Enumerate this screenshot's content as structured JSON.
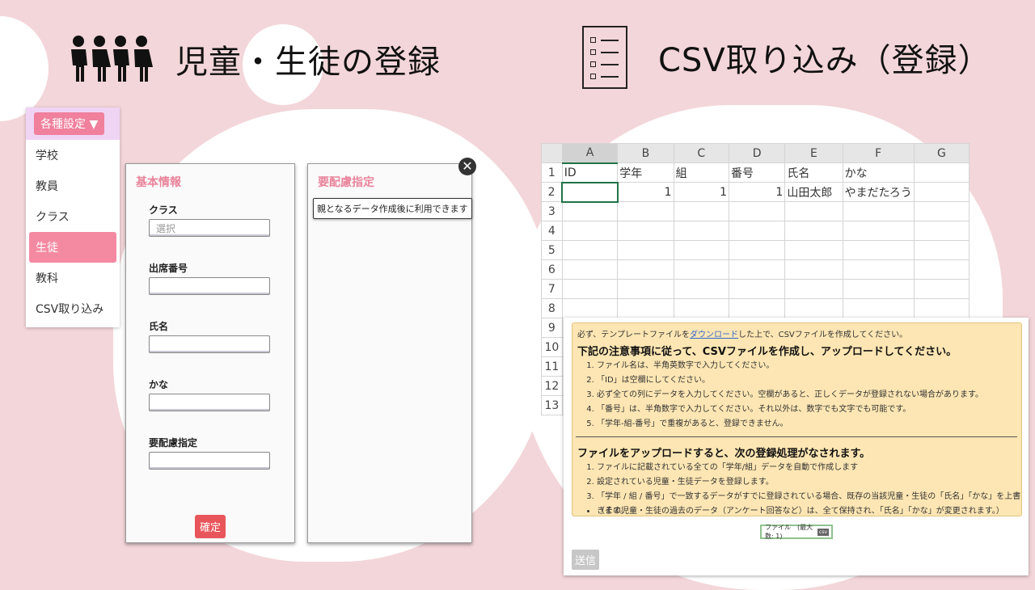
{
  "left_title": {
    "icon": "people-icon",
    "text": "児童・生徒の登録"
  },
  "right_title": {
    "icon": "checklist-icon",
    "text": "CSV取り込み（登録）"
  },
  "settings_menu": {
    "button_label": "各種設定 ▼",
    "items": [
      {
        "label": "学校",
        "active": false
      },
      {
        "label": "教員",
        "active": false
      },
      {
        "label": "クラス",
        "active": false
      },
      {
        "label": "生徒",
        "active": true
      },
      {
        "label": "教科",
        "active": false
      },
      {
        "label": "CSV取り込み",
        "active": false
      }
    ]
  },
  "basic_info": {
    "title": "基本情報",
    "fields": {
      "class_label": "クラス",
      "class_placeholder": "選択",
      "number_label": "出席番号",
      "name_label": "氏名",
      "kana_label": "かな",
      "care_label": "要配慮指定"
    },
    "confirm_button": "確定"
  },
  "care_panel": {
    "title": "要配慮指定",
    "close_icon": "close-icon",
    "tooltip": "親となるデータ作成後に利用できます"
  },
  "spreadsheet": {
    "columns": [
      "A",
      "B",
      "C",
      "D",
      "E",
      "F",
      "G"
    ],
    "rows": [
      "1",
      "2",
      "3",
      "4",
      "5",
      "6",
      "7",
      "8",
      "9",
      "10",
      "11",
      "12",
      "13"
    ],
    "header_row": [
      "ID",
      "学年",
      "組",
      "番号",
      "氏名",
      "かな",
      ""
    ],
    "data_row": [
      "",
      "1",
      "1",
      "1",
      "山田太郎",
      "やまだたろう",
      ""
    ]
  },
  "instructions": {
    "line_pre": "必ず、テンプレートファイルを",
    "link": "ダウンロード",
    "line_post": "した上で、CSVファイルを作成してください。",
    "heading1": "下記の注意事項に従って、CSVファイルを作成し、アップロードしてください。",
    "rules": [
      "ファイル名は、半角英数字で入力してください。",
      "「ID」は空欄にしてください。",
      "必ず全ての列にデータを入力してください。空欄があると、正しくデータが登録されない場合があります。",
      "「番号」は、半角数字で入力してください。それ以外は、数字でも文字でも可能です。",
      "「学年-組-番号」で重複があると、登録できません。"
    ],
    "heading2": "ファイルをアップロードすると、次の登録処理がなされます。",
    "process": [
      "ファイルに記載されている全ての「学年/組」データを自動で作成します",
      "設定されている児童・生徒データを登録します。",
      "「学年 / 組 / 番号」で一致するデータがすでに登録されている場合、既存の当該児童・生徒の「氏名」「かな」を上書きます。"
    ],
    "note": "（その児童・生徒の過去のデータ（アンケート回答など）は、全て保持され、「氏名」「かな」が変更されます。）",
    "file_label": "ファイル　(最大数: 1)",
    "file_badge": "csv",
    "send_button": "送信"
  }
}
